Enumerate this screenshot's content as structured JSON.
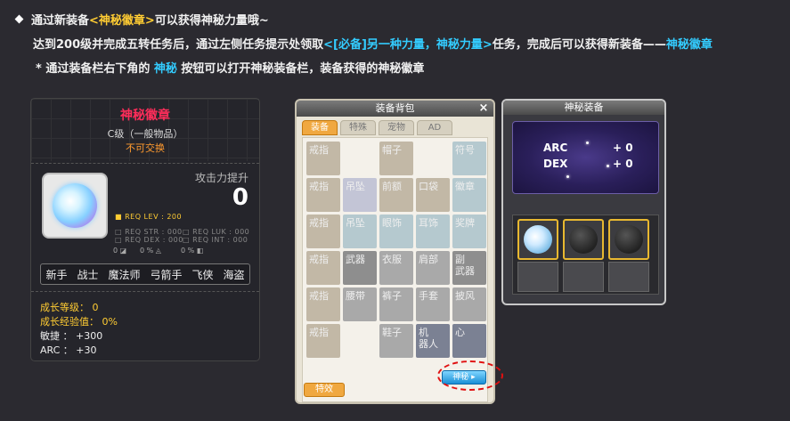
{
  "header": {
    "line1_pre": "通过新装备",
    "line1_item": "<神秘徽章>",
    "line1_post": "可以获得神秘力量哦~",
    "line2_pre": "达到200级并完成五转任务后，通过左侧任务提示处领取",
    "line2_quest": "<[必备]另一种力量，神秘力量>",
    "line2_mid": "任务，完成后可以获得新装备——",
    "line2_item": "神秘徽章",
    "line3_pre": "* 通过装备栏右下角的 ",
    "line3_btn": "神秘",
    "line3_post": " 按钮可以打开神秘装备栏，装备获得的神秘徽章"
  },
  "tooltip": {
    "title": "神秘徽章",
    "grade": "C级（一般物品）",
    "trade": "不可交换",
    "attack_label": "攻击力提升",
    "attack_value": "0",
    "req_lev": "■ REQ LEV : 200",
    "req_str": "□ REQ STR : 000",
    "req_dex": "□ REQ DEX : 000",
    "req_luk": "□ REQ LUK : 000",
    "req_int": "□ REQ INT : 000",
    "icon_vals": [
      "0",
      "0 %",
      "0 %"
    ],
    "jobs": [
      "新手",
      "战士",
      "魔法师",
      "弓箭手",
      "飞侠",
      "海盗"
    ],
    "grow_level": "成长等级： 0",
    "grow_exp": "成长经验值： 0%",
    "agility": "敏捷 ： +300",
    "arc": "ARC ： +30"
  },
  "bag": {
    "title": "装备背包",
    "close": "×",
    "tabs": [
      "装备",
      "特殊",
      "宠物",
      "AD"
    ],
    "slots": [
      {
        "label": "戒指",
        "style": "tan"
      },
      {
        "label": "",
        "style": ""
      },
      {
        "label": "帽子",
        "style": "tan"
      },
      {
        "label": "",
        "style": ""
      },
      {
        "label": "符号",
        "style": "blue"
      },
      {
        "label": "戒指",
        "style": "tan"
      },
      {
        "label": "吊坠",
        "style": "lav"
      },
      {
        "label": "前额",
        "style": "tan"
      },
      {
        "label": "口袋",
        "style": "tan"
      },
      {
        "label": "徽章",
        "style": "blue"
      },
      {
        "label": "戒指",
        "style": "tan"
      },
      {
        "label": "吊坠",
        "style": "blue"
      },
      {
        "label": "眼饰",
        "style": "blue"
      },
      {
        "label": "耳饰",
        "style": "blue"
      },
      {
        "label": "奖牌",
        "style": "blue"
      },
      {
        "label": "戒指",
        "style": "tan"
      },
      {
        "label": "武器",
        "style": "dark"
      },
      {
        "label": "衣服",
        "style": "gray"
      },
      {
        "label": "肩部",
        "style": "gray"
      },
      {
        "label": "副\n武器",
        "style": "dark"
      },
      {
        "label": "戒指",
        "style": "tan"
      },
      {
        "label": "腰带",
        "style": "gray"
      },
      {
        "label": "裤子",
        "style": "gray"
      },
      {
        "label": "手套",
        "style": "gray"
      },
      {
        "label": "披风",
        "style": "gray"
      },
      {
        "label": "戒指",
        "style": "tan"
      },
      {
        "label": "",
        "style": ""
      },
      {
        "label": "鞋子",
        "style": "gray"
      },
      {
        "label": "机\n器人",
        "style": "dpur"
      },
      {
        "label": "心",
        "style": "dpur"
      }
    ],
    "special_btn": "特效",
    "mystic_btn": "神秘 ▸"
  },
  "mystic": {
    "title": "神秘装备",
    "arc_label": "ARC",
    "arc_value": "+ 0",
    "dex_label": "DEX",
    "dex_value": "+ 0"
  },
  "colors": {
    "accent_yellow": "#ffcc33",
    "accent_cyan": "#33ccff",
    "item_red": "#ff2d5a"
  }
}
